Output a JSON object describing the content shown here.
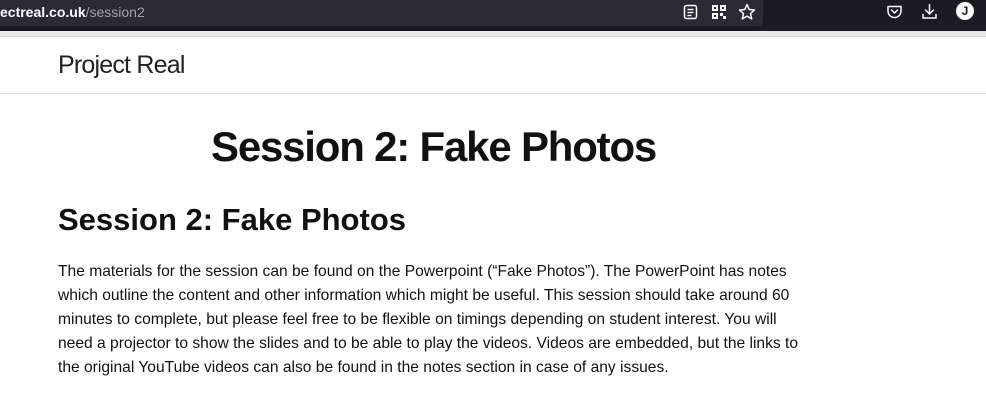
{
  "browser": {
    "url_host": "ectreal.co.uk",
    "url_path": "/session2",
    "profile_initial": "J"
  },
  "site": {
    "title": "Project Real"
  },
  "main": {
    "page_title": "Session 2: Fake Photos",
    "section_heading": "Session 2: Fake Photos",
    "paragraph": "The materials for the session can be found on the Powerpoint (“Fake Photos”). The PowerPoint has notes which outline the content and other information which might be useful. This session should take around 60 minutes to complete, but please feel free to be flexible on timings depending on student interest. You will need a projector to show the slides and to be able to play the videos. Videos are embedded, but the links to the original YouTube videos can also be found in the notes section in case of any issues."
  },
  "icons": {
    "reader": "reader-view-icon",
    "qr": "qr-code-icon",
    "bookmark": "bookmark-star-icon",
    "pocket": "pocket-icon",
    "downloads": "download-icon",
    "account": "account-avatar-icon"
  }
}
